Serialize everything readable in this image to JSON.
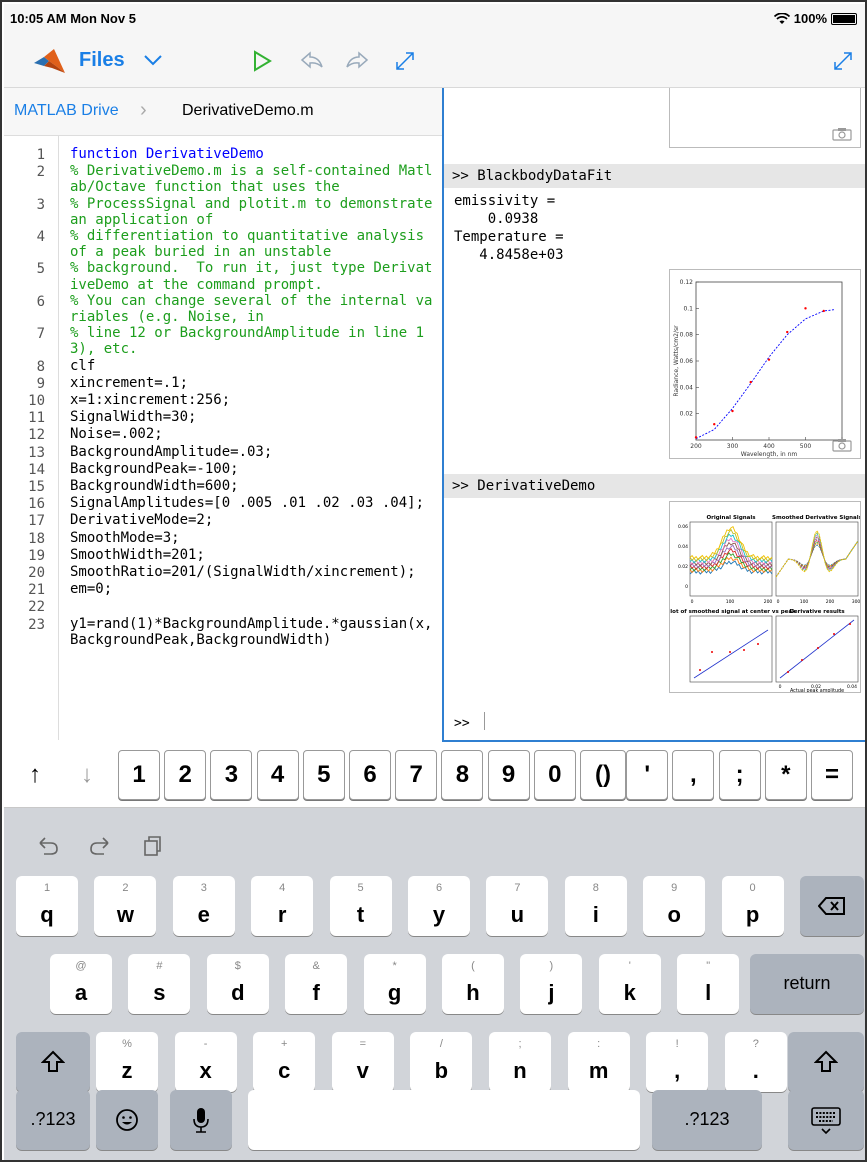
{
  "status": {
    "time": "10:05 AM  Mon Nov 5",
    "battery": "100%"
  },
  "toolbar": {
    "files_label": "Files"
  },
  "breadcrumb": {
    "drive": "MATLAB Drive",
    "file": "DerivativeDemo.m"
  },
  "editor": {
    "lines": [
      {
        "n": "1",
        "text": "function DerivativeDemo",
        "type": "keyword"
      },
      {
        "n": "2",
        "text": "% DerivativeDemo.m is a self-contained Matlab/Octave function that uses the",
        "type": "comment"
      },
      {
        "n": "3",
        "text": "% ProcessSignal and plotit.m to demonstrate an application of",
        "type": "comment"
      },
      {
        "n": "4",
        "text": "% differentiation to quantitative analysis of a peak buried in an unstable",
        "type": "comment"
      },
      {
        "n": "5",
        "text": "% background.  To run it, just type DerivativeDemo at the command prompt.",
        "type": "comment"
      },
      {
        "n": "6",
        "text": "% You can change several of the internal variables (e.g. Noise, in",
        "type": "comment"
      },
      {
        "n": "7",
        "text": "% line 12 or BackgroundAmplitude in line 13), etc.",
        "type": "comment"
      },
      {
        "n": "8",
        "text": "clf",
        "type": "code"
      },
      {
        "n": "9",
        "text": "xincrement=.1;",
        "type": "code"
      },
      {
        "n": "10",
        "text": "x=1:xincrement:256;",
        "type": "code"
      },
      {
        "n": "11",
        "text": "SignalWidth=30;",
        "type": "code"
      },
      {
        "n": "12",
        "text": "Noise=.002;",
        "type": "code"
      },
      {
        "n": "13",
        "text": "BackgroundAmplitude=.03;",
        "type": "code"
      },
      {
        "n": "14",
        "text": "BackgroundPeak=-100;",
        "type": "code"
      },
      {
        "n": "15",
        "text": "BackgroundWidth=600;",
        "type": "code"
      },
      {
        "n": "16",
        "text": "SignalAmplitudes=[0 .005 .01 .02 .03 .04];",
        "type": "code"
      },
      {
        "n": "17",
        "text": "DerivativeMode=2;",
        "type": "code"
      },
      {
        "n": "18",
        "text": "SmoothMode=3;",
        "type": "code"
      },
      {
        "n": "19",
        "text": "SmoothWidth=201;",
        "type": "code"
      },
      {
        "n": "20",
        "text": "SmoothRatio=201/(SignalWidth/xincrement);",
        "type": "code"
      },
      {
        "n": "21",
        "text": "em=0;",
        "type": "code"
      },
      {
        "n": "22",
        "text": "",
        "type": "code"
      },
      {
        "n": "23",
        "text": "y1=rand(1)*BackgroundAmplitude.*gaussian(x,BackgroundPeak,BackgroundWidth)",
        "type": "code"
      }
    ]
  },
  "console": {
    "cmd1": ">> BlackbodyDataFit",
    "out1": "emissivity =\n    0.0938\nTemperature =\n   4.8458e+03",
    "cmd2": ">> DerivativeDemo",
    "prompt": ">>"
  },
  "chart_data": [
    {
      "type": "scatter",
      "title": "",
      "xlabel": "Wavelength, in nm",
      "ylabel": "Radiance, Watts/cm2/sr",
      "xlim": [
        200,
        600
      ],
      "ylim": [
        0,
        0.12
      ],
      "x_ticks": [
        "200",
        "300",
        "400",
        "500",
        "600"
      ],
      "y_ticks": [
        "0.02",
        "0.04",
        "0.06",
        "0.08",
        "0.1",
        "0.12"
      ],
      "series": [
        {
          "kind": "points",
          "color": "#ff0000",
          "x": [
            200,
            250,
            300,
            350,
            400,
            450,
            500,
            550
          ],
          "y": [
            0.002,
            0.012,
            0.022,
            0.044,
            0.061,
            0.082,
            0.1,
            0.098
          ]
        },
        {
          "kind": "fit-line",
          "color": "#0000ff",
          "x": [
            200,
            250,
            300,
            350,
            400,
            450,
            500,
            550,
            580
          ],
          "y": [
            0.001,
            0.008,
            0.024,
            0.043,
            0.063,
            0.08,
            0.092,
            0.098,
            0.099
          ]
        }
      ]
    },
    {
      "type": "line",
      "panels": [
        {
          "title": "Original Signals",
          "yticks": [
            "0.06",
            "0.04",
            "0.02",
            "0"
          ],
          "xticks": [
            "0",
            "100",
            "200"
          ]
        },
        {
          "title": "Smoothed Derivative Signals",
          "xticks": [
            "0",
            "100",
            "200",
            "300"
          ]
        },
        {
          "title": "Plot of smoothed signal at center vs peak"
        },
        {
          "title": "Derivative results",
          "xlabel": "Actual peak amplitude",
          "xticks": [
            "0",
            "0.02",
            "0.04"
          ]
        }
      ]
    }
  ],
  "keyboard": {
    "numrow": [
      "1",
      "2",
      "3",
      "4",
      "5",
      "6",
      "7",
      "8",
      "9",
      "0",
      "()",
      "'",
      ",",
      ";",
      "*",
      "="
    ],
    "row1": [
      [
        "1",
        "q"
      ],
      [
        "2",
        "w"
      ],
      [
        "3",
        "e"
      ],
      [
        "4",
        "r"
      ],
      [
        "5",
        "t"
      ],
      [
        "6",
        "y"
      ],
      [
        "7",
        "u"
      ],
      [
        "8",
        "i"
      ],
      [
        "9",
        "o"
      ],
      [
        "0",
        "p"
      ]
    ],
    "row2": [
      [
        "@",
        "a"
      ],
      [
        "#",
        "s"
      ],
      [
        "$",
        "d"
      ],
      [
        "&",
        "f"
      ],
      [
        "*",
        "g"
      ],
      [
        "(",
        "h"
      ],
      [
        ")",
        "j"
      ],
      [
        "'",
        "k"
      ],
      [
        "\"",
        "l"
      ]
    ],
    "row3": [
      [
        "%",
        "z"
      ],
      [
        "-",
        "x"
      ],
      [
        "+",
        "c"
      ],
      [
        "=",
        "v"
      ],
      [
        "/",
        "b"
      ],
      [
        ";",
        "n"
      ],
      [
        ":",
        "m"
      ],
      [
        "!",
        ","
      ],
      [
        "?",
        "."
      ]
    ],
    "return_label": "return",
    "mode_label": ".?123"
  }
}
